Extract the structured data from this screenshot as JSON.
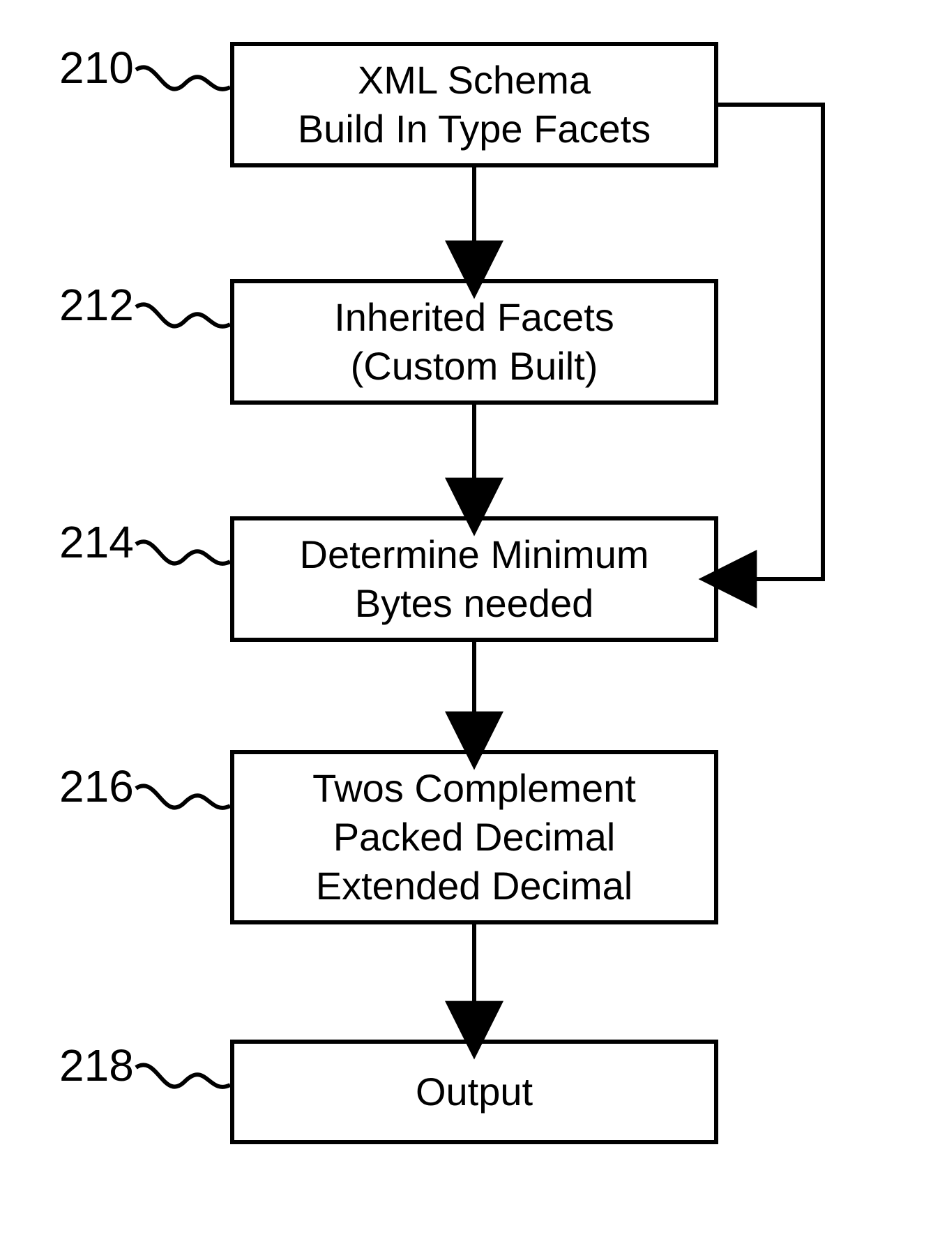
{
  "boxes": {
    "b210": {
      "line1": "XML Schema",
      "line2": "Build In Type Facets"
    },
    "b212": {
      "line1": "Inherited Facets",
      "line2": "(Custom Built)"
    },
    "b214": {
      "line1": "Determine Minimum",
      "line2": "Bytes needed"
    },
    "b216": {
      "line1": "Twos Complement",
      "line2": "Packed Decimal",
      "line3": "Extended Decimal"
    },
    "b218": {
      "line1": "Output"
    }
  },
  "labels": {
    "l210": "210",
    "l212": "212",
    "l214": "214",
    "l216": "216",
    "l218": "218"
  }
}
